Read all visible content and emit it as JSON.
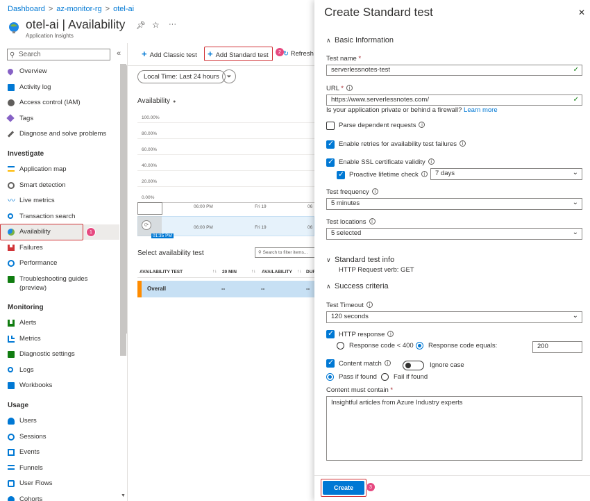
{
  "breadcrumb": [
    "Dashboard",
    "az-monitor-rg",
    "otel-ai"
  ],
  "header": {
    "title": "otel-ai | Availability",
    "subtitle": "Application Insights",
    "more": "···"
  },
  "sidebar": {
    "search_placeholder": "Search",
    "collapse": "«",
    "top_items": [
      "Overview",
      "Activity log",
      "Access control (IAM)",
      "Tags",
      "Diagnose and solve problems"
    ],
    "investigate_title": "Investigate",
    "investigate_items": [
      "Application map",
      "Smart detection",
      "Live metrics",
      "Transaction search",
      "Availability",
      "Failures",
      "Performance",
      "Troubleshooting guides",
      "(preview)"
    ],
    "monitoring_title": "Monitoring",
    "monitoring_items": [
      "Alerts",
      "Metrics",
      "Diagnostic settings",
      "Logs",
      "Workbooks"
    ],
    "usage_title": "Usage",
    "usage_items": [
      "Users",
      "Sessions",
      "Events",
      "Funnels",
      "User Flows",
      "Cohorts"
    ],
    "badge_availability": "1"
  },
  "toolbar": {
    "add_classic": "Add Classic test",
    "add_standard": "Add Standard test",
    "refresh": "Refresh",
    "badge": "2"
  },
  "filter": {
    "time": "Local Time: Last 24 hours"
  },
  "chart": {
    "title": "Availability",
    "y_ticks": [
      "100.00%",
      "80.00%",
      "60.00%",
      "40.00%",
      "20.00%",
      "0.00%"
    ],
    "x_ticks": [
      "06:00 PM",
      "Fri 19",
      "06"
    ],
    "brush_ticks": [
      "06:00 PM",
      "Fri 19",
      "06"
    ],
    "time_marker": "01:35 PM"
  },
  "tests": {
    "title": "Select availability test",
    "search_placeholder": "Search to filter items...",
    "columns": [
      "AVAILABILITY TEST",
      "20 MIN",
      "AVAILABILITY",
      "DUR"
    ],
    "rows": [
      {
        "name": "Overall",
        "min20": "--",
        "availability": "--",
        "dur": "--"
      }
    ]
  },
  "panel": {
    "title": "Create Standard test",
    "close": "✕",
    "basic_info": "Basic Information",
    "test_name_label": "Test name",
    "test_name_value": "serverlessnotes-test",
    "url_label": "URL",
    "url_value": "https://www.serverlessnotes.com/",
    "private_text": "Is your application private or behind a firewall?",
    "learn_more": "Learn more",
    "parse_dependent": "Parse dependent requests",
    "enable_retries": "Enable retries for availability test failures",
    "enable_ssl": "Enable SSL certificate validity",
    "proactive": "Proactive lifetime check",
    "proactive_value": "7 days",
    "frequency_label": "Test frequency",
    "frequency_value": "5 minutes",
    "locations_label": "Test locations",
    "locations_value": "5 selected",
    "std_info": "Standard test info",
    "http_verb": "HTTP Request verb: GET",
    "success_criteria": "Success criteria",
    "timeout_label": "Test Timeout",
    "timeout_value": "120 seconds",
    "http_response": "HTTP response",
    "code_lt": "Response code < 400",
    "code_eq": "Response code equals:",
    "code_value": "200",
    "content_match": "Content match",
    "ignore_case": "Ignore case",
    "pass_if": "Pass if found",
    "fail_if": "Fail if found",
    "content_label": "Content must contain",
    "content_value": "Insightful articles from Azure Industry experts",
    "create": "Create",
    "badge": "3"
  },
  "colors": {
    "accent": "#0078d4",
    "badge": "#e64980",
    "highlight": "#d13438",
    "success": "#107c10"
  }
}
